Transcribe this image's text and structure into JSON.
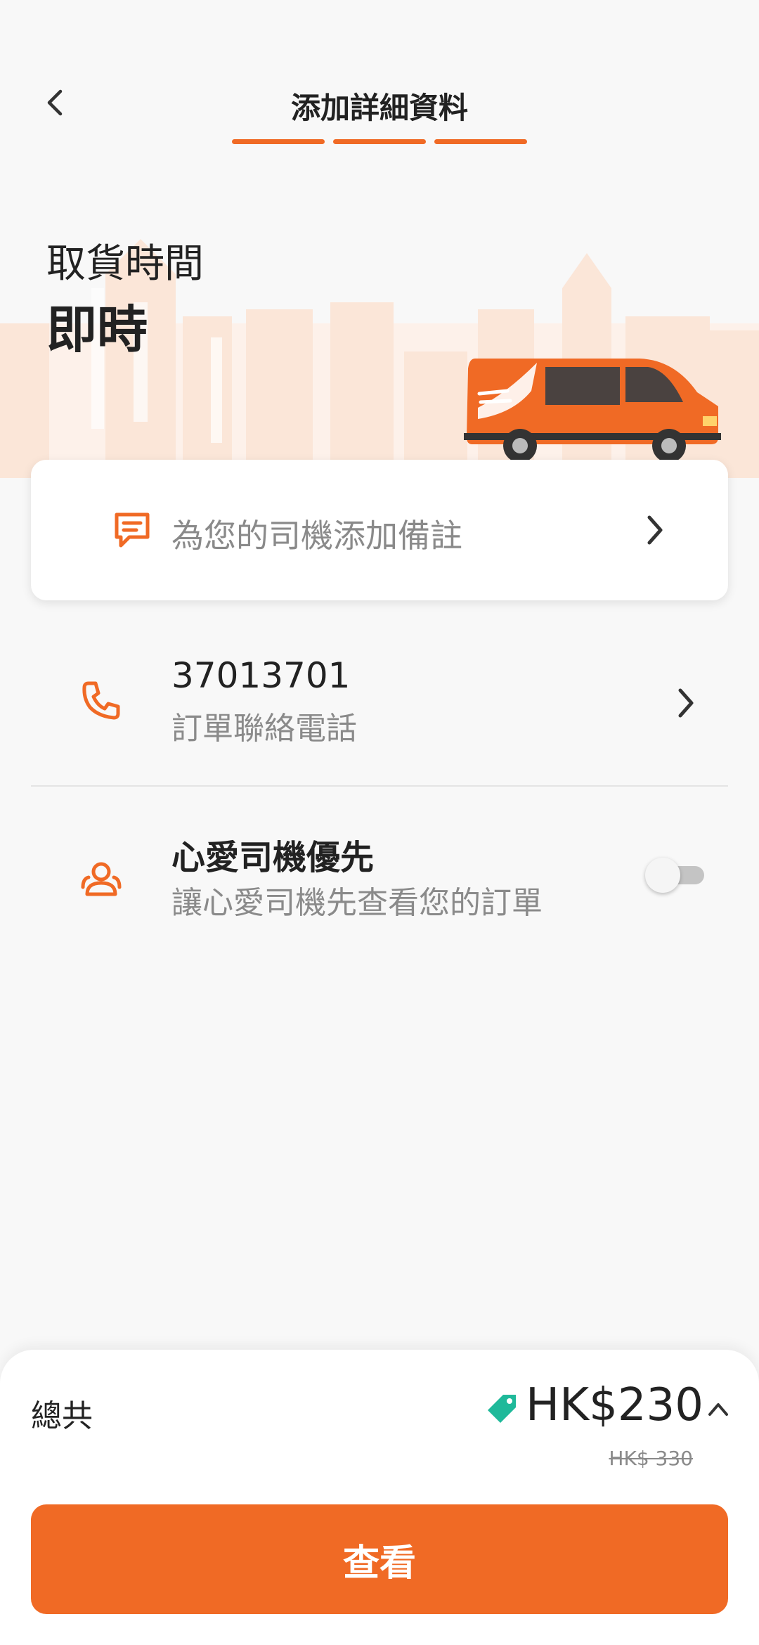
{
  "header": {
    "title": "添加詳細資料",
    "steps_total": 3,
    "steps_completed": 3
  },
  "pickup": {
    "label": "取貨時間",
    "value": "即時"
  },
  "note_card": {
    "label": "為您的司機添加備註",
    "icon": "message-icon"
  },
  "contact": {
    "phone": "37013701",
    "label": "訂單聯絡電話",
    "icon": "phone-icon"
  },
  "favorite_driver": {
    "title": "心愛司機優先",
    "subtitle": "讓心愛司機先查看您的訂單",
    "icon": "users-icon",
    "enabled": false
  },
  "summary": {
    "total_label": "總共",
    "price": "HK$230",
    "original_price": "HK$ 330",
    "cta_label": "查看"
  },
  "colors": {
    "accent": "#f06a25",
    "tag": "#1fb99a",
    "muted_text": "#8a8a8a"
  }
}
